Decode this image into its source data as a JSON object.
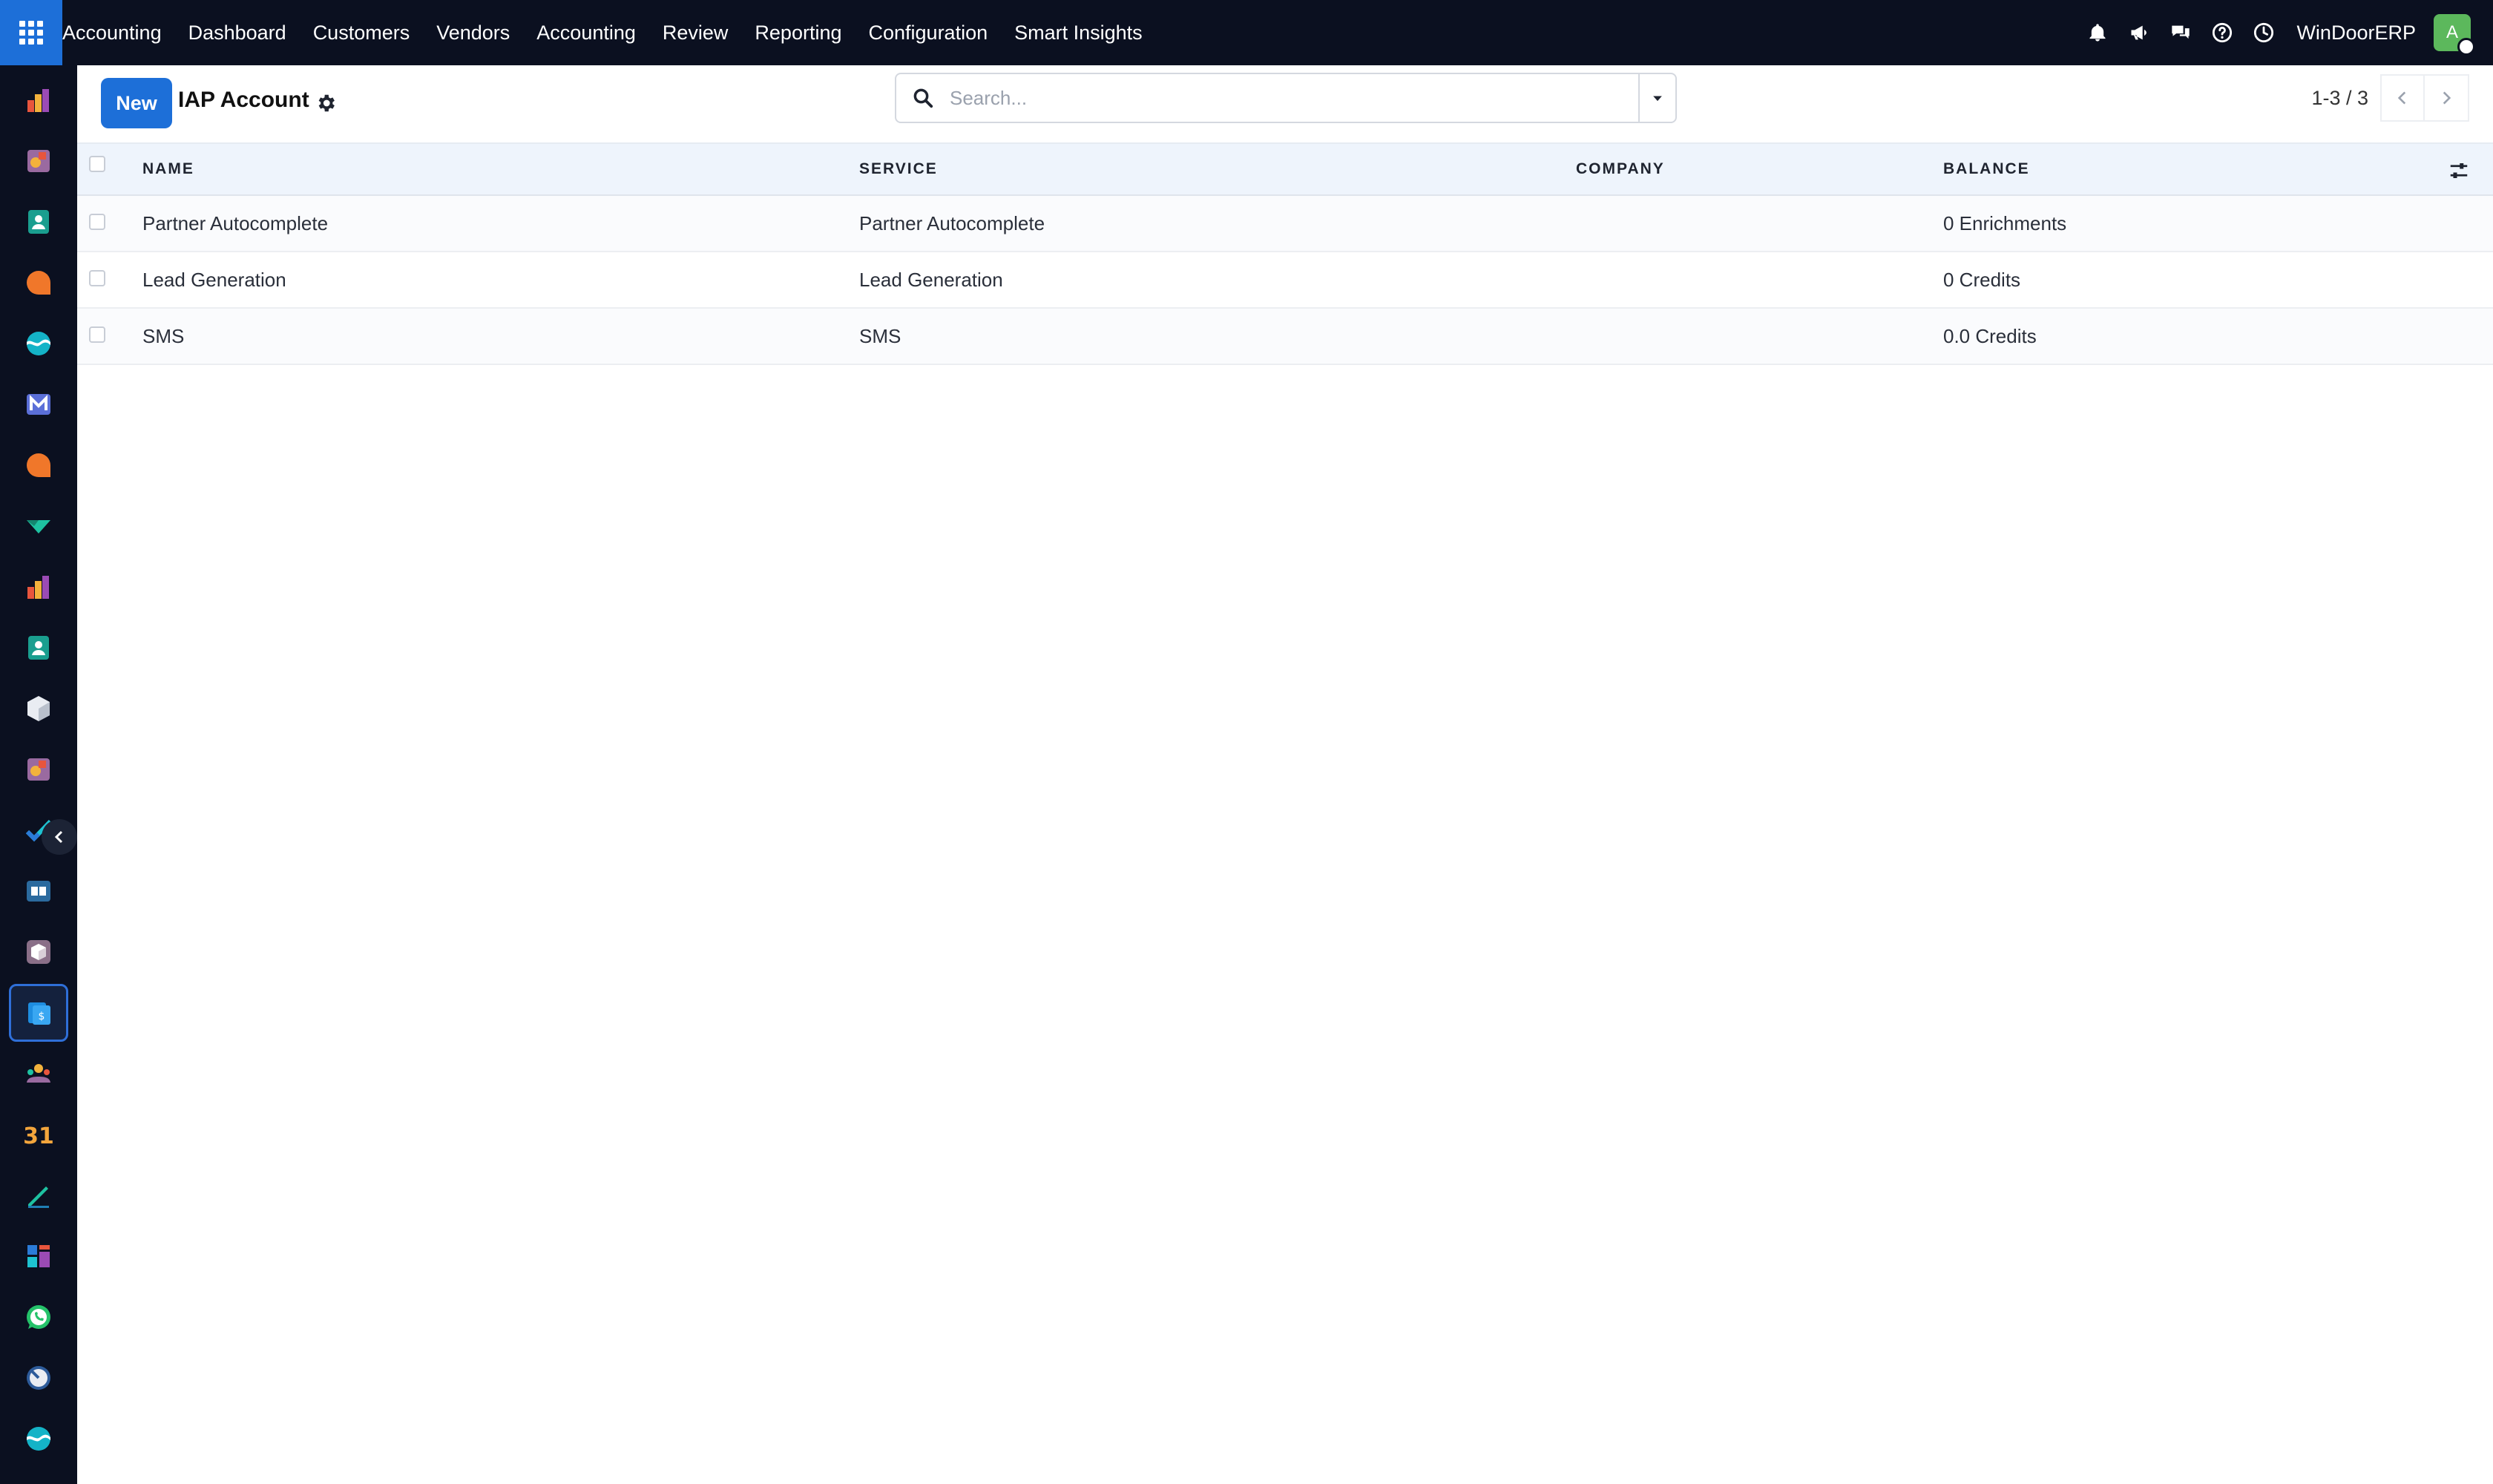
{
  "topbar": {
    "brand": "Accounting",
    "menu": [
      "Dashboard",
      "Customers",
      "Vendors",
      "Accounting",
      "Review",
      "Reporting",
      "Configuration",
      "Smart Insights"
    ],
    "company": "WinDoorERP",
    "avatar_letter": "A"
  },
  "sidebar": {
    "items": [
      "chart-bars-icon",
      "palette-icon",
      "contact-card-icon",
      "chat-bubble-icon",
      "wave-icon",
      "mail-icon",
      "chat-bubble-icon",
      "check-chevron-icon",
      "chart-bars-icon",
      "contact-card-icon",
      "cube-icon",
      "palette-icon",
      "task-check-icon",
      "book-icon",
      "box-icon",
      "invoice-icon",
      "people-icon",
      "calendar-icon",
      "pen-icon",
      "dashboard-icon",
      "whatsapp-icon",
      "gauge-icon",
      "wave-icon"
    ],
    "active_index": 15,
    "calendar_text": "31"
  },
  "control_panel": {
    "new_label": "New",
    "title": "IAP Account",
    "search_placeholder": "Search...",
    "pager": "1-3 / 3"
  },
  "table": {
    "columns": [
      "NAME",
      "SERVICE",
      "COMPANY",
      "BALANCE"
    ],
    "rows": [
      {
        "name": "Partner Autocomplete",
        "service": "Partner Autocomplete",
        "company": "",
        "balance": "0 Enrichments"
      },
      {
        "name": "Lead Generation",
        "service": "Lead Generation",
        "company": "",
        "balance": "0 Credits"
      },
      {
        "name": "SMS",
        "service": "SMS",
        "company": "",
        "balance": "0.0 Credits"
      }
    ]
  },
  "colors": {
    "topbar_bg": "#0b1020",
    "accent": "#1d6fd8",
    "header_row_bg": "#eef4fc",
    "avatar_bg": "#5cb85c"
  }
}
